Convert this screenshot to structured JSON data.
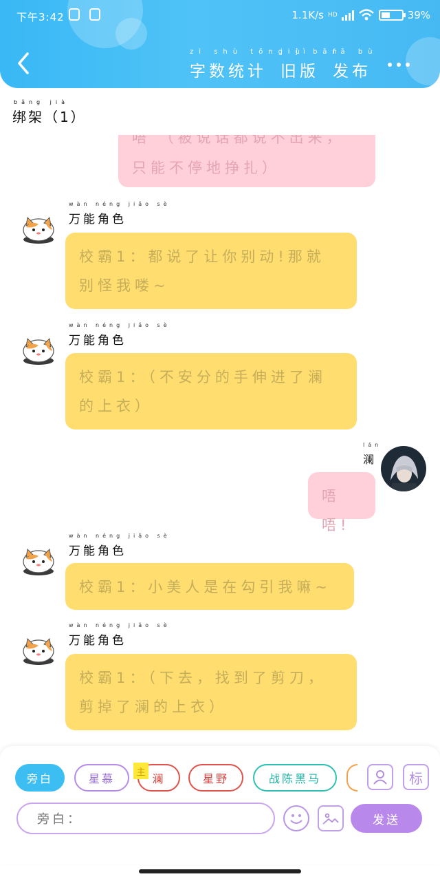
{
  "status": {
    "time": "下午3:42",
    "network": "1.1K/s",
    "hd": "HD",
    "battery": "39%"
  },
  "header": {
    "tabs": [
      {
        "label": "字数统计",
        "pinyin": "zì shù tǒng jì"
      },
      {
        "label": "旧版",
        "pinyin": "jiù bǎn"
      },
      {
        "label": "发布",
        "pinyin": "fā bù"
      }
    ]
  },
  "section": {
    "title": "绑架（1）",
    "pinyin": "bǎng jià"
  },
  "messages": [
    {
      "side": "right",
      "color": "pink",
      "text": "唔 （被说话都说不出来，只能不停地挣扎）",
      "partial": true
    },
    {
      "side": "left",
      "name": "万能角色",
      "name_pinyin": "wàn néng jiǎo sè",
      "color": "yellow",
      "text": "校霸1：都说了让你别动!那就别怪我喽~"
    },
    {
      "side": "left",
      "name": "万能角色",
      "name_pinyin": "wàn néng jiǎo sè",
      "color": "yellow",
      "text": "校霸1：（不安分的手伸进了澜的上衣）"
    },
    {
      "side": "right",
      "name": "澜",
      "name_pinyin": "lán",
      "color": "pink",
      "text": "唔唔!"
    },
    {
      "side": "left",
      "name": "万能角色",
      "name_pinyin": "wàn néng jiǎo sè",
      "color": "yellow",
      "text": "校霸1：小美人是在勾引我嘛~"
    },
    {
      "side": "left",
      "name": "万能角色",
      "name_pinyin": "wàn néng jiǎo sè",
      "color": "yellow",
      "text": "校霸1：（下去，找到了剪刀，剪掉了澜的上衣）"
    }
  ],
  "composer": {
    "chips": [
      {
        "label": "旁白",
        "active": true
      },
      {
        "label": "星慕"
      },
      {
        "label": "澜",
        "badge": "主"
      },
      {
        "label": "星野"
      },
      {
        "label": "战陈黑马"
      }
    ],
    "tag_button": "标",
    "input_label": "旁白：",
    "send_label": "发送"
  },
  "colors": {
    "header": "#46b9f3",
    "yellow_bubble": "#ffdd6f",
    "pink_bubble": "#ffd0da",
    "accent_purple": "#b889ea"
  }
}
